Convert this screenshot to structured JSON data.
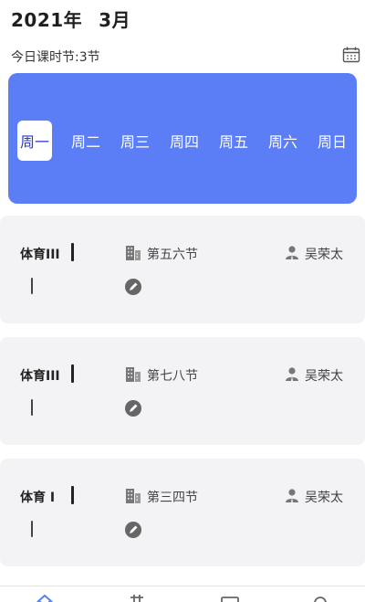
{
  "header": {
    "year": "2021年",
    "month": "3月"
  },
  "subtitle": "今日课时节:3节",
  "icons": {
    "calendar": "calendar-icon",
    "building": "building-icon",
    "teacher": "user-icon",
    "status": "pencil-circle-icon"
  },
  "colors": {
    "accent": "#5b7ef6",
    "active_text": "#2d3bd1",
    "card_bg": "#f3f3f5"
  },
  "week": {
    "days": [
      "周一",
      "周二",
      "周三",
      "周四",
      "周五",
      "周六",
      "周日"
    ],
    "selected": "周一"
  },
  "courses": [
    {
      "name": "体育III",
      "session": "第五六节",
      "teacher": "吴荣太"
    },
    {
      "name": "体育III",
      "session": "第七八节",
      "teacher": "吴荣太"
    },
    {
      "name": "体育 I",
      "session": "第三四节",
      "teacher": "吴荣太"
    }
  ],
  "tabbar": {
    "items": [
      "home-icon",
      "grid-icon",
      "calendar-icon",
      "profile-icon"
    ],
    "active": "home-icon"
  }
}
